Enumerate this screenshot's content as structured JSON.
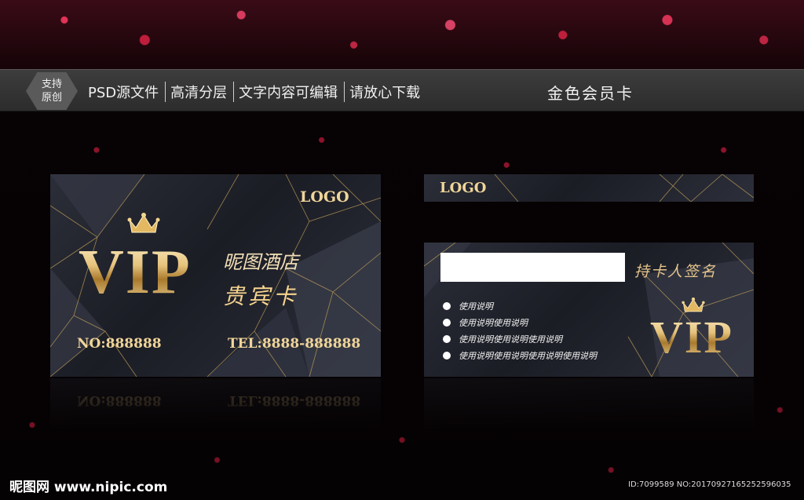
{
  "banner": {
    "badge": "支持原创",
    "features": [
      "PSD源文件",
      "高清分层",
      "文字内容可编辑",
      "请放心下载"
    ],
    "title": "金色会员卡"
  },
  "front_card": {
    "logo": "LOGO",
    "vip": "VIP",
    "hotel_name": "昵图酒店",
    "card_type": "贵宾卡",
    "number": "NO:888888",
    "phone": "TEL:8888-888888"
  },
  "back_card": {
    "logo": "LOGO",
    "signature_label": "持卡人签名",
    "notes": [
      "使用说明",
      "使用说明使用说明",
      "使用说明使用说明使用说明",
      "使用说明使用说明使用说明使用说明"
    ],
    "vip": "VIP"
  },
  "footer": {
    "watermark": "昵图网 www.nipic.com",
    "id_line": "ID:7099589 NO:20170927165252596035"
  },
  "colors": {
    "gold": "#e9c98a",
    "card_bg": "#22252e",
    "banner_bg": "#333333",
    "glitter": "#e0224f"
  },
  "icons": [
    "crown-icon",
    "bullet-dot-icon"
  ]
}
